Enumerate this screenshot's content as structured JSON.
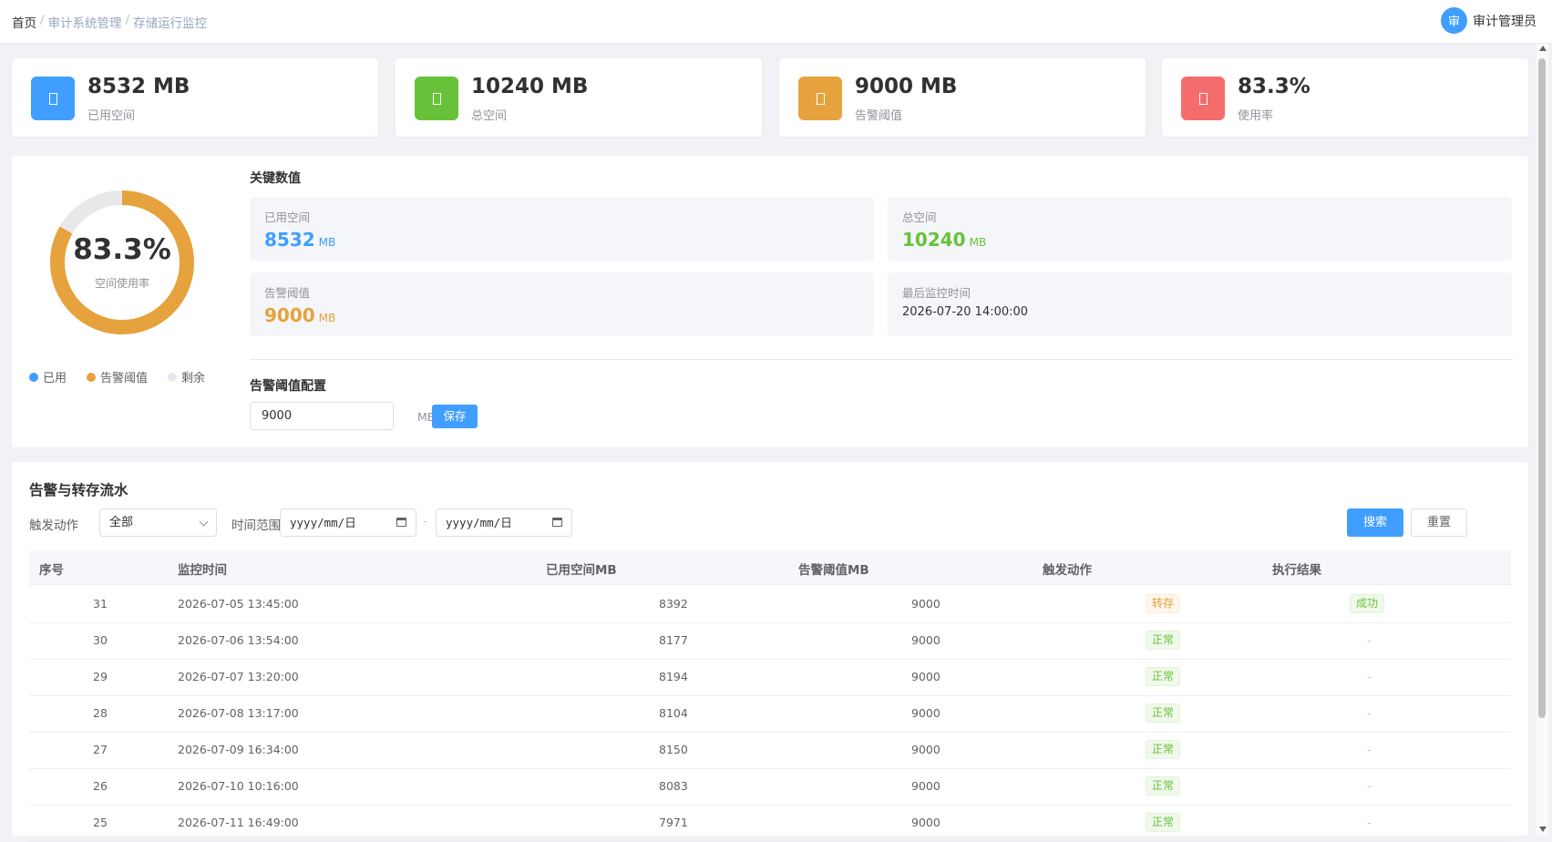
{
  "breadcrumb": {
    "home": "首页",
    "sep": "/",
    "parent": "审计系统管理",
    "current": "存储运行监控"
  },
  "user": {
    "avatar": "审",
    "name": "审计管理员"
  },
  "stats": [
    {
      "value": "8532 MB",
      "label": "已用空间",
      "color": "#409eff",
      "icon": "storage-icon"
    },
    {
      "value": "10240 MB",
      "label": "总空间",
      "color": "#67c23a",
      "icon": "database-icon"
    },
    {
      "value": "9000 MB",
      "label": "告警阈值",
      "color": "#e6a23c",
      "icon": "warning-icon"
    },
    {
      "value": "83.3%",
      "label": "使用率",
      "color": "#f56c6c",
      "icon": "chart-icon"
    }
  ],
  "usage": {
    "percent_text": "83.3%",
    "percent": 83.3,
    "subtitle": "空间使用率",
    "legend": [
      {
        "label": "已用",
        "color": "#409eff"
      },
      {
        "label": "告警阈值",
        "color": "#e6a23c"
      },
      {
        "label": "剩余",
        "color": "#e4e7ed"
      }
    ]
  },
  "key_values": {
    "title": "关键数值",
    "used": {
      "label": "已用空间",
      "value": "8532",
      "unit": "MB",
      "color": "#409eff"
    },
    "total": {
      "label": "总空间",
      "value": "10240",
      "unit": "MB",
      "color": "#67c23a"
    },
    "threshold": {
      "label": "告警阈值",
      "value": "9000",
      "unit": "MB",
      "color": "#e6a23c"
    },
    "last_time": {
      "label": "最后监控时间",
      "value": "2026-07-20 14:00:00"
    }
  },
  "threshold_config": {
    "title": "告警阈值配置",
    "value": "9000",
    "unit": "MB",
    "save_label": "保存"
  },
  "log": {
    "title": "告警与转存流水",
    "filters": {
      "action_label": "触发动作",
      "action_value": "全部",
      "range_label": "时间范围",
      "date_placeholder": "yyyy/mm/日",
      "date_sep": "-",
      "search_label": "搜索",
      "reset_label": "重置"
    },
    "columns": [
      "序号",
      "监控时间",
      "已用空间MB",
      "告警阈值MB",
      "触发动作",
      "执行结果"
    ],
    "rows": [
      {
        "id": "31",
        "time": "2026-07-05 13:45:00",
        "used": "8392",
        "threshold": "9000",
        "action": "转存",
        "action_type": "warn",
        "result": "成功"
      },
      {
        "id": "30",
        "time": "2026-07-06 13:54:00",
        "used": "8177",
        "threshold": "9000",
        "action": "正常",
        "action_type": "ok",
        "result": "-"
      },
      {
        "id": "29",
        "time": "2026-07-07 13:20:00",
        "used": "8194",
        "threshold": "9000",
        "action": "正常",
        "action_type": "ok",
        "result": "-"
      },
      {
        "id": "28",
        "time": "2026-07-08 13:17:00",
        "used": "8104",
        "threshold": "9000",
        "action": "正常",
        "action_type": "ok",
        "result": "-"
      },
      {
        "id": "27",
        "time": "2026-07-09 16:34:00",
        "used": "8150",
        "threshold": "9000",
        "action": "正常",
        "action_type": "ok",
        "result": "-"
      },
      {
        "id": "26",
        "time": "2026-07-10 10:16:00",
        "used": "8083",
        "threshold": "9000",
        "action": "正常",
        "action_type": "ok",
        "result": "-"
      },
      {
        "id": "25",
        "time": "2026-07-11 16:49:00",
        "used": "7971",
        "threshold": "9000",
        "action": "正常",
        "action_type": "ok",
        "result": "-"
      }
    ]
  }
}
